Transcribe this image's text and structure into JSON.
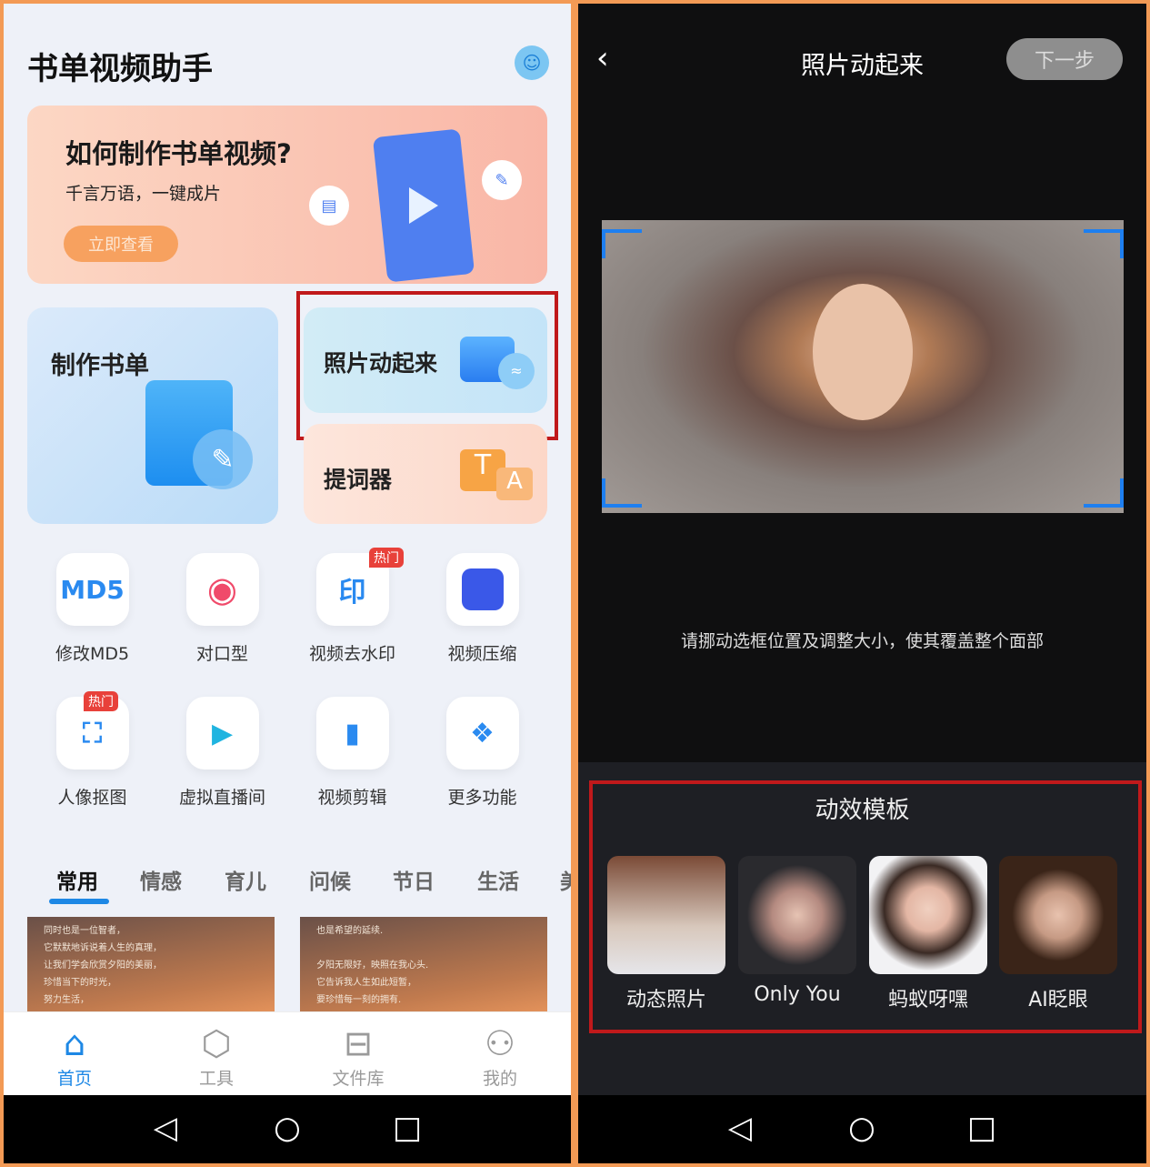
{
  "left": {
    "app_title": "书单视频助手",
    "banner": {
      "title": "如何制作书单视频?",
      "subtitle": "千言万语，一键成片",
      "button": "立即查看"
    },
    "cards": {
      "make_booklist": "制作书单",
      "animate_photo": "照片动起来",
      "teleprompter": "提词器"
    },
    "tools": [
      {
        "label": "修改MD5",
        "icon": "MD5",
        "badge": ""
      },
      {
        "label": "对口型",
        "icon": "lips-icon",
        "badge": ""
      },
      {
        "label": "视频去水印",
        "icon": "印",
        "badge": "热门"
      },
      {
        "label": "视频压缩",
        "icon": "compress-icon",
        "badge": ""
      },
      {
        "label": "人像抠图",
        "icon": "portrait-icon",
        "badge": "热门"
      },
      {
        "label": "虚拟直播间",
        "icon": "tv-icon",
        "badge": ""
      },
      {
        "label": "视频剪辑",
        "icon": "film-icon",
        "badge": ""
      },
      {
        "label": "更多功能",
        "icon": "grid-icon",
        "badge": ""
      }
    ],
    "tabs": [
      "常用",
      "情感",
      "育儿",
      "问候",
      "节日",
      "生活",
      "美"
    ],
    "thumbs": [
      [
        "同时也是一位智者，",
        "它默默地诉说着人生的真理，",
        "让我们学会欣赏夕阳的美丽，",
        "珍惜当下的时光，",
        "努力生活，"
      ],
      [
        "也是希望的延续.",
        "",
        "夕阳无限好，映照在我心头.",
        "它告诉我人生如此短暂，",
        "要珍惜每一刻的拥有."
      ]
    ],
    "nav": [
      "首页",
      "工具",
      "文件库",
      "我的"
    ],
    "accent": "#1e88e5"
  },
  "right": {
    "title": "照片动起来",
    "next": "下一步",
    "hint": "请挪动选框位置及调整大小，使其覆盖整个面部",
    "templates_title": "动效模板",
    "templates": [
      "动态照片",
      "Only You",
      "蚂蚁呀嘿",
      "AI眨眼"
    ]
  },
  "highlight_color": "#c0191b"
}
